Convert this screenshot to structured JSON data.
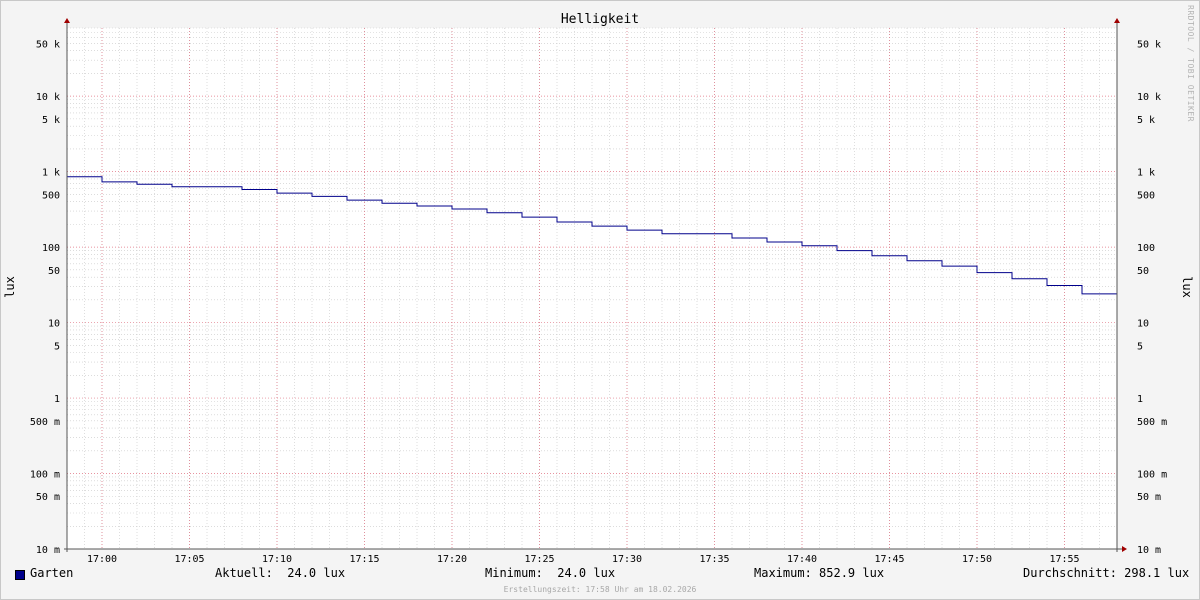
{
  "chart_data": {
    "type": "line",
    "line_style": "step",
    "title": "Helligkeit",
    "ylabel": "lux",
    "y_scale": "log",
    "ylim": [
      0.01,
      80000
    ],
    "y_ticks": [
      {
        "value": 50000,
        "label": "50 k"
      },
      {
        "value": 10000,
        "label": "10 k"
      },
      {
        "value": 5000,
        "label": "5 k"
      },
      {
        "value": 1000,
        "label": "1 k"
      },
      {
        "value": 500,
        "label": "500"
      },
      {
        "value": 100,
        "label": "100"
      },
      {
        "value": 50,
        "label": "50"
      },
      {
        "value": 10,
        "label": "10"
      },
      {
        "value": 5,
        "label": "5"
      },
      {
        "value": 1,
        "label": "1"
      },
      {
        "value": 0.5,
        "label": "500 m"
      },
      {
        "value": 0.1,
        "label": "100 m"
      },
      {
        "value": 0.05,
        "label": "50 m"
      },
      {
        "value": 0.01,
        "label": "10 m"
      }
    ],
    "xlim": [
      "16:58",
      "17:58"
    ],
    "x_ticks": [
      "17:00",
      "17:05",
      "17:10",
      "17:15",
      "17:20",
      "17:25",
      "17:30",
      "17:35",
      "17:40",
      "17:45",
      "17:50",
      "17:55"
    ],
    "grid": true,
    "series": [
      {
        "name": "Garten",
        "color": "#00008b",
        "x": [
          "16:58",
          "17:00",
          "17:02",
          "17:04",
          "17:06",
          "17:08",
          "17:10",
          "17:12",
          "17:14",
          "17:16",
          "17:18",
          "17:20",
          "17:22",
          "17:24",
          "17:26",
          "17:28",
          "17:30",
          "17:32",
          "17:34",
          "17:36",
          "17:38",
          "17:40",
          "17:42",
          "17:44",
          "17:46",
          "17:48",
          "17:50",
          "17:52",
          "17:54",
          "17:56"
        ],
        "y": [
          852.9,
          730,
          680,
          630,
          630,
          580,
          520,
          470,
          420,
          380,
          350,
          320,
          285,
          250,
          215,
          190,
          168,
          150,
          150,
          132,
          117,
          104,
          90,
          77,
          66,
          56,
          46,
          38,
          31,
          24
        ]
      }
    ]
  },
  "legend": {
    "series_name": "Garten",
    "current": "Aktuell:  24.0 lux",
    "minimum": "Minimum:  24.0 lux",
    "maximum": "Maximum: 852.9 lux",
    "average": "Durchschnitt: 298.1 lux"
  },
  "created": "Erstellungszeit: 17:58 Uhr am 18.02.2026",
  "watermark": "RRDTOOL / TOBI OETIKER",
  "colors": {
    "background": "#f4f4f4",
    "plot_background": "#ffffff",
    "series": "#00008b",
    "minor_grid": "#c8c8c8",
    "major_grid": "#e07080"
  }
}
